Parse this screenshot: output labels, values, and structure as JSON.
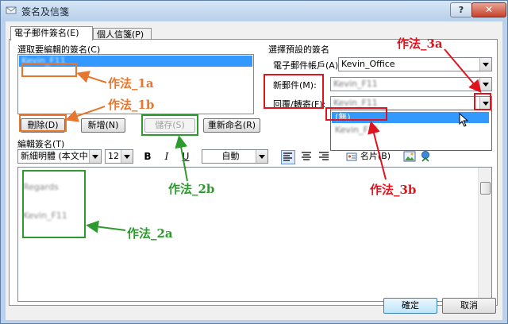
{
  "window": {
    "title": "簽名及信箋",
    "help_label": "?",
    "close_label": "✕"
  },
  "tabs": [
    {
      "label": "電子郵件簽名(E)"
    },
    {
      "label": "個人信箋(P)"
    }
  ],
  "left": {
    "list_label": "選取要編輯的簽名(C)",
    "selected_item": "Kevin_F11",
    "buttons": {
      "delete": "刪除(D)",
      "new": "新增(N)",
      "save": "儲存(S)",
      "rename": "重新命名(R)"
    }
  },
  "right": {
    "group_label": "選擇預設的簽名",
    "account_label": "電子郵件帳戶(A):",
    "account_value": "Kevin_Office",
    "new_messages_label": "新郵件(M):",
    "new_messages_value": "Kevin_F11",
    "replies_label": "回覆/轉寄(F):",
    "replies_value": "Kevin_F11",
    "dropdown_options": [
      "(無)",
      "Kevin_F11"
    ]
  },
  "editor": {
    "label": "編輯簽名(T)",
    "font": "新細明體 (本文中",
    "size": "12",
    "bold": "B",
    "italic": "I",
    "underline": "U",
    "color": "自動",
    "business_card": "名片(B)",
    "content_lines": [
      "Regards",
      "Kevin_F11"
    ]
  },
  "footer": {
    "ok": "確定",
    "cancel": "取消"
  },
  "annotations": {
    "a1a": "作法_1a",
    "a1b": "作法_1b",
    "a2a": "作法_2a",
    "a2b": "作法_2b",
    "a3a": "作法_3a",
    "a3b": "作法_3b"
  },
  "colors": {
    "orange": "#e8762c",
    "green": "#2c9a2c",
    "red": "#e0141e",
    "selection": "#3399ff"
  }
}
